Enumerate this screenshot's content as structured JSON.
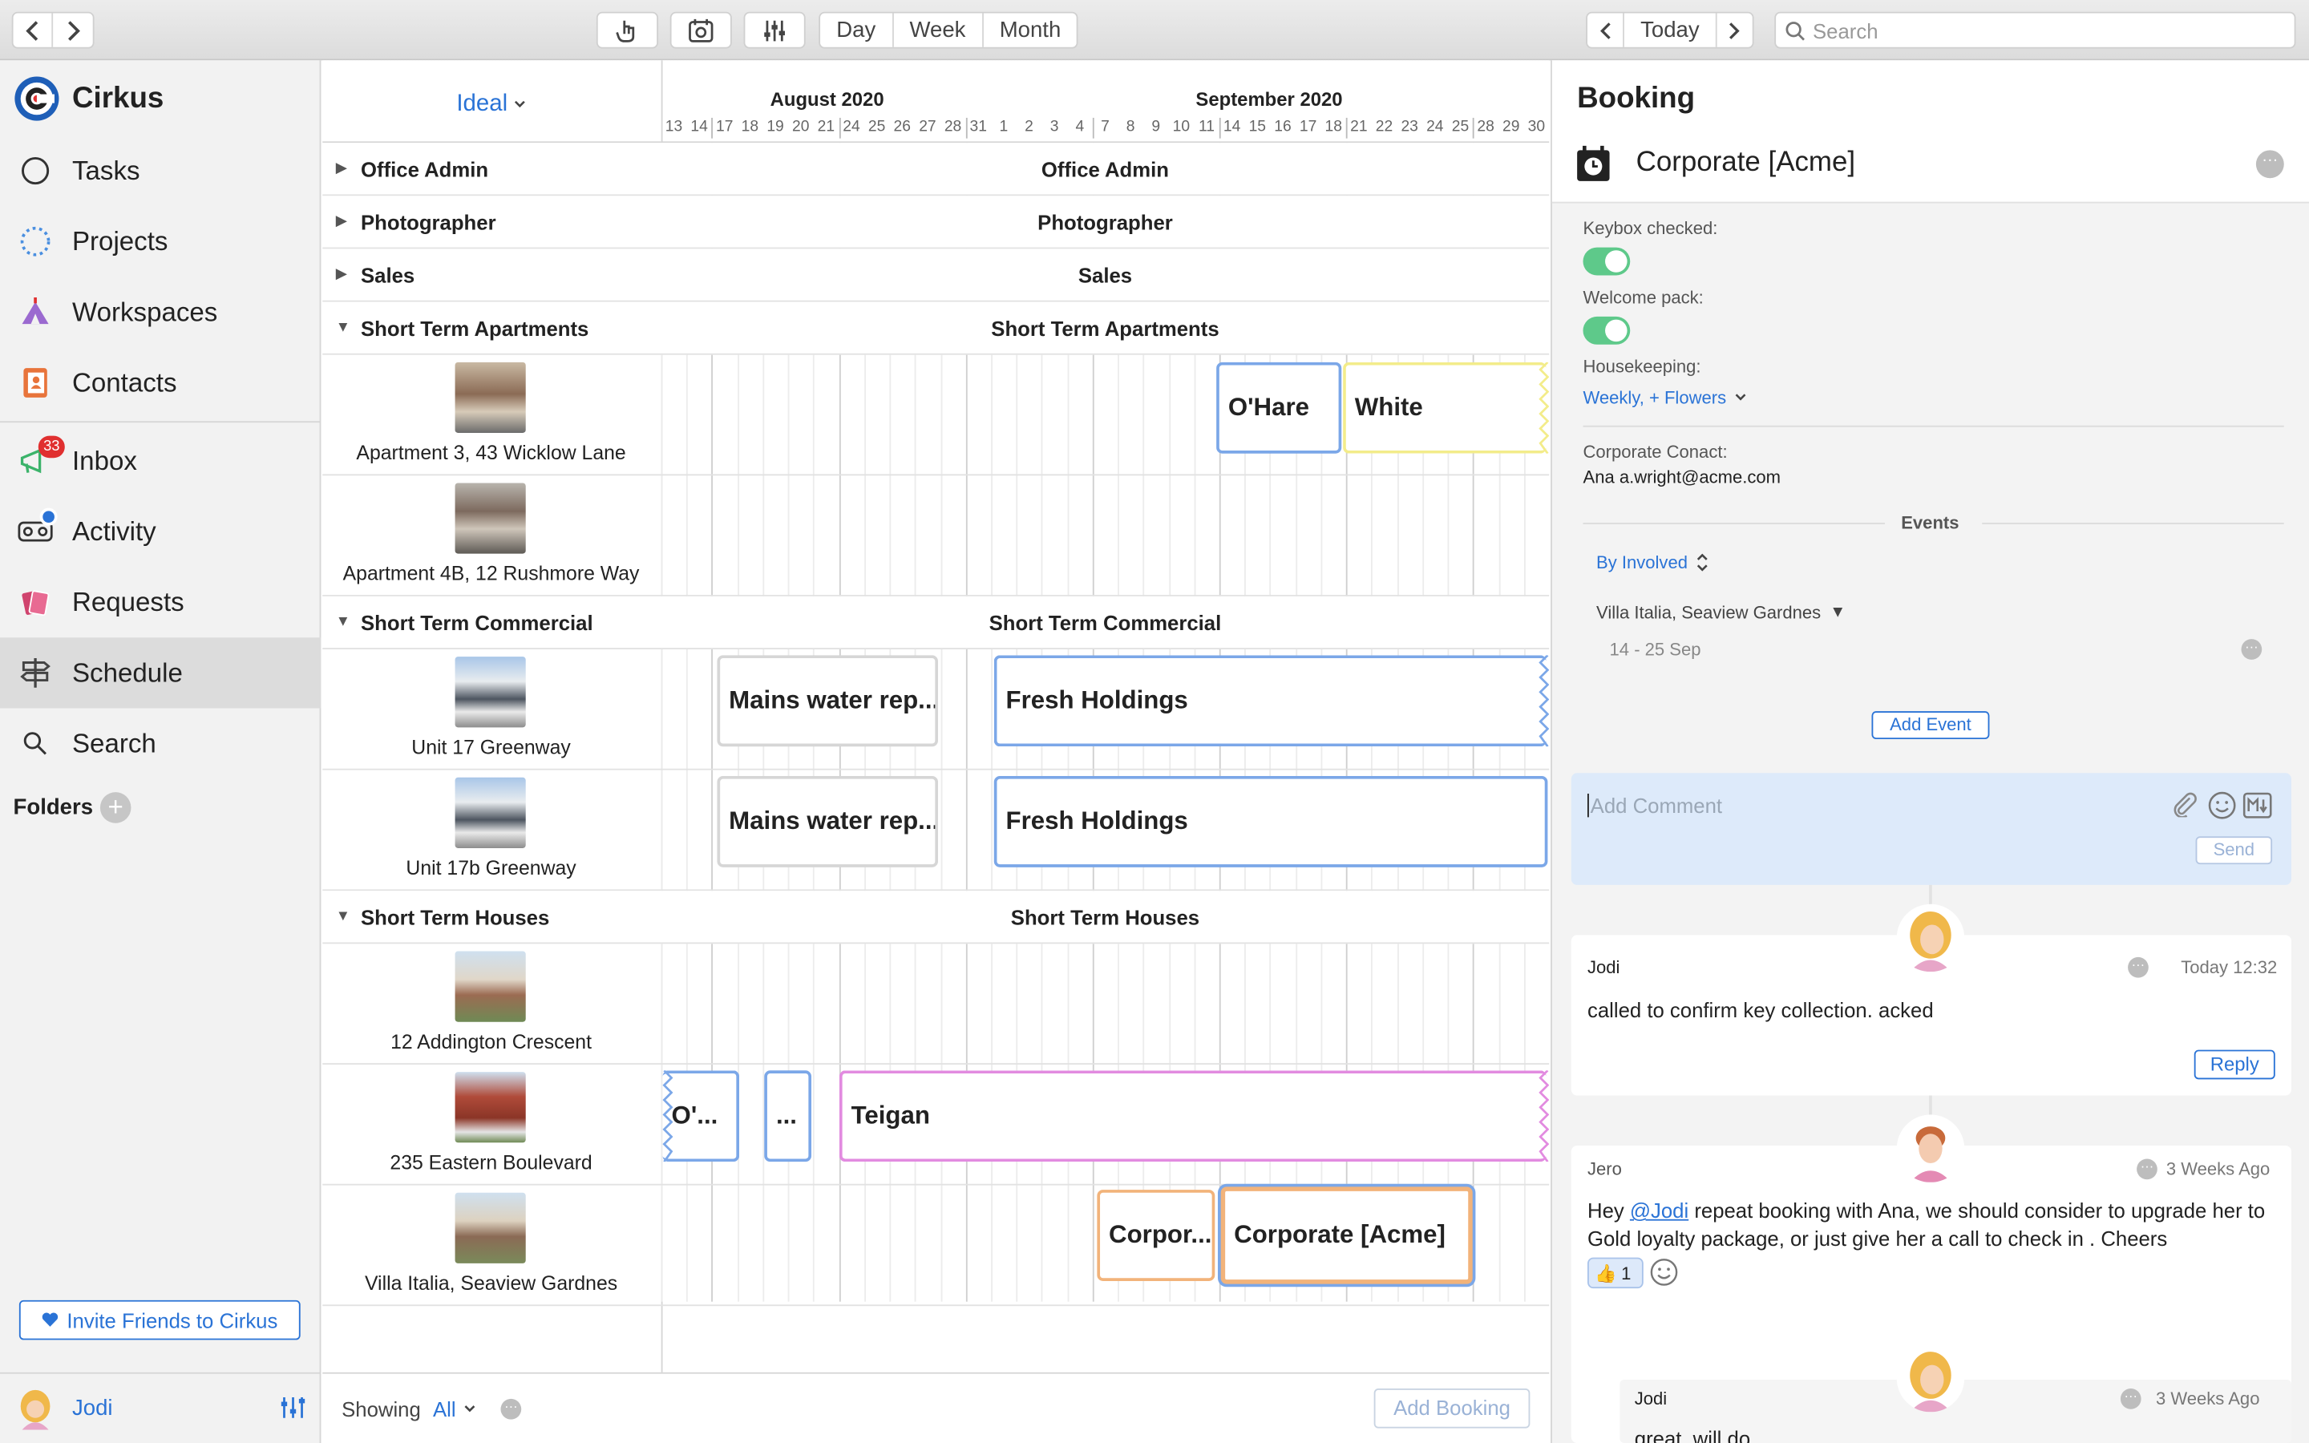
{
  "toolbar": {
    "views": [
      "Day",
      "Week",
      "Month"
    ],
    "today_label": "Today",
    "search_placeholder": "Search"
  },
  "sidebar": {
    "app_name": "Cirkus",
    "items": [
      {
        "label": "Tasks",
        "icon": "circle-icon"
      },
      {
        "label": "Projects",
        "icon": "dotted-circle-icon"
      },
      {
        "label": "Workspaces",
        "icon": "tent-icon"
      },
      {
        "label": "Contacts",
        "icon": "contact-book-icon"
      },
      {
        "label": "Inbox",
        "icon": "megaphone-icon",
        "badge": "33"
      },
      {
        "label": "Activity",
        "icon": "voicemail-icon"
      },
      {
        "label": "Requests",
        "icon": "cards-icon"
      },
      {
        "label": "Schedule",
        "icon": "signpost-icon",
        "selected": true
      },
      {
        "label": "Search",
        "icon": "magnifier-icon"
      }
    ],
    "folders_label": "Folders",
    "invite_label": "Invite Friends to Cirkus",
    "user_name": "Jodi"
  },
  "schedule": {
    "view_selector": "Ideal",
    "months": [
      "August 2020",
      "September 2020"
    ],
    "days": [
      "13",
      "14",
      "17",
      "18",
      "19",
      "20",
      "21",
      "24",
      "25",
      "26",
      "27",
      "28",
      "31",
      "1",
      "2",
      "3",
      "4",
      "7",
      "8",
      "9",
      "10",
      "11",
      "14",
      "15",
      "16",
      "17",
      "18",
      "21",
      "22",
      "23",
      "24",
      "25",
      "28",
      "29",
      "30"
    ],
    "groups": [
      {
        "name": "Office Admin",
        "expanded": false
      },
      {
        "name": "Photographer",
        "expanded": false
      },
      {
        "name": "Sales",
        "expanded": false
      },
      {
        "name": "Short Term Apartments",
        "expanded": true
      },
      {
        "name": "Short Term Commercial",
        "expanded": true
      },
      {
        "name": "Short Term Houses",
        "expanded": true
      }
    ],
    "resources": [
      "Apartment 3, 43 Wicklow Lane",
      "Apartment 4B, 12 Rushmore Way",
      "Unit 17 Greenway",
      "Unit 17b Greenway",
      "12 Addington Crescent",
      "235 Eastern Boulevard",
      "Villa Italia, Seaview Gardnes"
    ],
    "bookings": [
      {
        "label": "O'Hare",
        "color": "#7ba7e8"
      },
      {
        "label": "White",
        "color": "#f3ec8a"
      },
      {
        "label": "Mains water rep...",
        "color": "#d6d6d6"
      },
      {
        "label": "Fresh Holdings",
        "color": "#7ba7e8"
      },
      {
        "label": "Mains water rep...",
        "color": "#d6d6d6"
      },
      {
        "label": "Fresh Holdings",
        "color": "#7ba7e8"
      },
      {
        "label": "O'...",
        "color": "#7ba7e8"
      },
      {
        "label": "...",
        "color": "#7ba7e8"
      },
      {
        "label": "Teigan",
        "color": "#e28be0"
      },
      {
        "label": "Corpor...",
        "color": "#f2b37a"
      },
      {
        "label": "Corporate [Acme]",
        "color": "#f2b37a"
      }
    ],
    "footer_showing": "Showing",
    "footer_filter": "All",
    "add_booking": "Add Booking"
  },
  "panel": {
    "title": "Booking",
    "booking_name": "Corporate [Acme]",
    "keybox_label": "Keybox checked:",
    "welcome_label": "Welcome pack:",
    "housekeeping_label": "Housekeeping:",
    "housekeeping_value": "Weekly, + Flowers",
    "contact_label": "Corporate Conact:",
    "contact_value": "Ana a.wright@acme.com",
    "events_label": "Events",
    "filter_label": "By Involved",
    "event_place": "Villa Italia, Seaview Gardnes",
    "event_dates": "14 - 25 Sep",
    "add_event": "Add Event",
    "comment_placeholder": "Add Comment",
    "send_label": "Send",
    "comments": [
      {
        "author": "Jodi",
        "time": "Today 12:32",
        "text": "called to confirm key collection. acked",
        "reply": "Reply"
      },
      {
        "author": "Jero",
        "time": "3 Weeks Ago",
        "mention": "@Jodi",
        "text_before": "Hey ",
        "text_after": " repeat booking with Ana, we should consider to upgrade her to Gold loyalty package, or just give her a call to check in . Cheers",
        "reaction": "1"
      },
      {
        "author": "Jodi",
        "time": "3 Weeks Ago",
        "text": "great, will do"
      }
    ]
  },
  "colors": {
    "accent": "#2a73d6",
    "toggle": "#5ec98a",
    "selected_nav": "#dcdcdc",
    "badge": "#e03030"
  }
}
